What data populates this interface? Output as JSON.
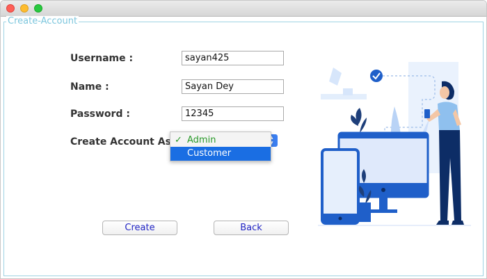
{
  "window": {
    "title": ""
  },
  "group": {
    "title": "Create-Account"
  },
  "form": {
    "username_label": "Username :",
    "username_value": "sayan425",
    "name_label": "Name :",
    "name_value": "Sayan Dey",
    "password_label": "Password :",
    "password_value": "12345",
    "account_type_label": "Create Account As :",
    "account_type_options": [
      {
        "label": "Admin",
        "selected": true
      },
      {
        "label": "Customer",
        "highlighted": true
      }
    ],
    "check_mark": "✓"
  },
  "buttons": {
    "create": "Create",
    "back": "Back"
  },
  "colors": {
    "accent": "#1a6ee3",
    "group_border": "#9fd3e3",
    "selected_option": "#2a9a2a",
    "button_text": "#2124c4",
    "illustration_blue": "#1f5fc9"
  }
}
